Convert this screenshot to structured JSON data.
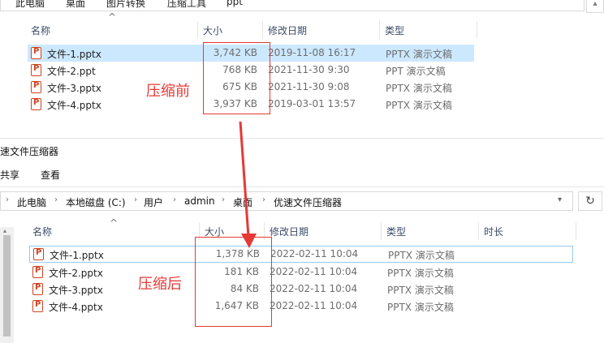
{
  "top_pane": {
    "address_crumbs": [
      "此电脑",
      "桌面",
      "图片转换",
      "压缩工具",
      "ppt"
    ],
    "columns": {
      "name": "名称",
      "size": "大小",
      "date": "修改日期",
      "type": "类型"
    },
    "files": [
      {
        "name": "文件-1.pptx",
        "size": "3,742 KB",
        "date": "2019-11-08 16:17",
        "type": "PPTX 演示文稿"
      },
      {
        "name": "文件-2.ppt",
        "size": "768 KB",
        "date": "2021-11-30 9:30",
        "type": "PPT 演示文稿"
      },
      {
        "name": "文件-3.pptx",
        "size": "675 KB",
        "date": "2021-11-30 9:08",
        "type": "PPTX 演示文稿"
      },
      {
        "name": "文件-4.pptx",
        "size": "3,937 KB",
        "date": "2019-03-01 13:57",
        "type": "PPTX 演示文稿"
      }
    ],
    "annotation_label": "压缩前"
  },
  "bottom_pane": {
    "window_title": "速文件压缩器",
    "ribbon_tabs": [
      "共享",
      "查看"
    ],
    "address_crumbs": [
      "此电脑",
      "本地磁盘 (C:)",
      "用户",
      "admin",
      "桌面",
      "优速文件压缩器"
    ],
    "columns": {
      "name": "名称",
      "size": "大小",
      "date": "修改日期",
      "type": "类型",
      "duration": "时长"
    },
    "files": [
      {
        "name": "文件-1.pptx",
        "size": "1,378 KB",
        "date": "2022-02-11 10:04",
        "type": "PPTX 演示文稿"
      },
      {
        "name": "文件-2.pptx",
        "size": "181 KB",
        "date": "2022-02-11 10:04",
        "type": "PPTX 演示文稿"
      },
      {
        "name": "文件-3.pptx",
        "size": "84 KB",
        "date": "2022-02-11 10:04",
        "type": "PPTX 演示文稿"
      },
      {
        "name": "文件-4.pptx",
        "size": "1,647 KB",
        "date": "2022-02-11 10:04",
        "type": "PPTX 演示文稿"
      }
    ],
    "annotation_label": "压缩后"
  },
  "icons": {
    "file": "pptx-file-icon",
    "refresh": "refresh-icon",
    "sort": "sort-ascending-icon",
    "annotation_arrow": "red-arrow-icon"
  },
  "colors": {
    "annotation": "#e53935",
    "selection": "#cce8ff",
    "header_text": "#3b4b67",
    "file_icon": "#d04423"
  }
}
